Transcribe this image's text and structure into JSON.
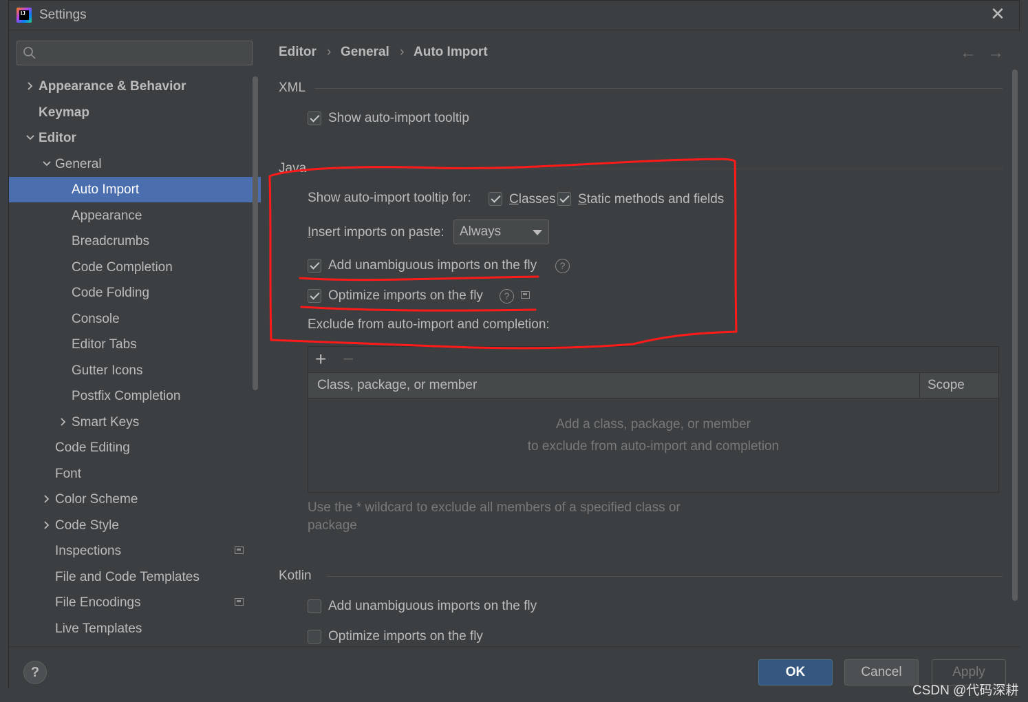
{
  "window": {
    "title": "Settings"
  },
  "search": {
    "placeholder": "",
    "value": ""
  },
  "tree": {
    "items": [
      {
        "label": "Appearance & Behavior",
        "chevron": "right"
      },
      {
        "label": "Keymap"
      },
      {
        "label": "Editor",
        "chevron": "down"
      },
      {
        "label": "General",
        "chevron": "down"
      },
      {
        "label": "Auto Import",
        "selected": true
      },
      {
        "label": "Appearance"
      },
      {
        "label": "Breadcrumbs"
      },
      {
        "label": "Code Completion"
      },
      {
        "label": "Code Folding"
      },
      {
        "label": "Console"
      },
      {
        "label": "Editor Tabs"
      },
      {
        "label": "Gutter Icons"
      },
      {
        "label": "Postfix Completion"
      },
      {
        "label": "Smart Keys",
        "chevron": "right"
      },
      {
        "label": "Code Editing"
      },
      {
        "label": "Font"
      },
      {
        "label": "Color Scheme",
        "chevron": "right"
      },
      {
        "label": "Code Style",
        "chevron": "right"
      },
      {
        "label": "Inspections",
        "icon": "project-icon"
      },
      {
        "label": "File and Code Templates"
      },
      {
        "label": "File Encodings",
        "icon": "project-icon"
      },
      {
        "label": "Live Templates"
      }
    ]
  },
  "breadcrumb": {
    "items": [
      "Editor",
      "General",
      "Auto Import"
    ],
    "separator": "›"
  },
  "nav": {
    "back": "←",
    "forward": "→"
  },
  "xml": {
    "title": "XML",
    "show_tooltip": {
      "label": "Show auto-import tooltip",
      "checked": true
    }
  },
  "java": {
    "title": "Java",
    "tooltip_for_label": "Show auto-import tooltip for:",
    "classes": {
      "label": "Classes",
      "checked": true
    },
    "static_methods": {
      "label": "Static methods and fields",
      "checked": true
    },
    "insert_on_paste_label": "Insert imports on paste:",
    "insert_on_paste_value": "Always",
    "add_unambiguous": {
      "label": "Add unambiguous imports on the fly",
      "checked": true
    },
    "optimize": {
      "label": "Optimize imports on the fly",
      "checked": true
    },
    "exclude_label": "Exclude from auto-import and completion:",
    "table": {
      "add": "+",
      "remove": "−",
      "columns": [
        "Class, package, or member",
        "Scope"
      ],
      "empty_line1": "Add a class, package, or member",
      "empty_line2": "to exclude from auto-import and completion"
    },
    "hint_line1": "Use the * wildcard to exclude all members of a specified class or",
    "hint_line2": "package"
  },
  "kotlin": {
    "title": "Kotlin",
    "add_unambiguous": {
      "label": "Add unambiguous imports on the fly",
      "checked": false
    },
    "optimize": {
      "label": "Optimize imports on the fly",
      "checked": false
    }
  },
  "footer": {
    "help": "?",
    "ok": "OK",
    "cancel": "Cancel",
    "apply": "Apply"
  },
  "watermark": "CSDN @代码深耕",
  "annotation_color": "#ff1a1a",
  "accent_selected": "#4b6eaf"
}
